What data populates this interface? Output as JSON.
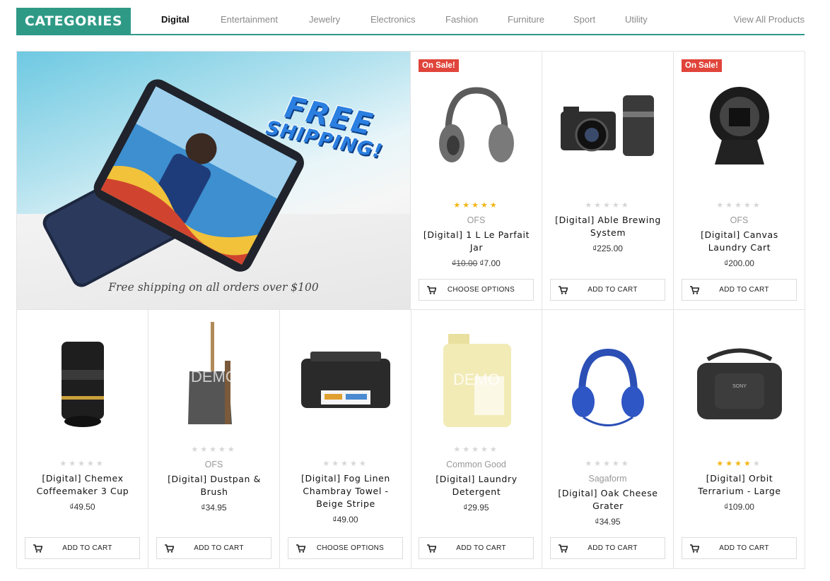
{
  "header": {
    "title": "CATEGORIES",
    "tabs": [
      {
        "label": "Digital",
        "active": true
      },
      {
        "label": "Entertainment",
        "active": false
      },
      {
        "label": "Jewelry",
        "active": false
      },
      {
        "label": "Electronics",
        "active": false
      },
      {
        "label": "Fashion",
        "active": false
      },
      {
        "label": "Furniture",
        "active": false
      },
      {
        "label": "Sport",
        "active": false
      },
      {
        "label": "Utility",
        "active": false
      }
    ],
    "view_all": "View All Products"
  },
  "banner": {
    "headline_line1": "FREE",
    "headline_line2": "SHIPPING!",
    "caption": "Free shipping on all orders over $100"
  },
  "colors": {
    "accent": "#2e9a86",
    "sale_badge": "#e0443a",
    "star_on": "#f3b512",
    "star_off": "#d6d6d6"
  },
  "products": [
    {
      "badge": "On Sale!",
      "image_icon": "headphones-gray-icon",
      "rating": 5,
      "vendor": "OFS",
      "title": "[Digital] 1 L Le Parfait Jar",
      "old_price": "₫10.00",
      "price": "₫7.00",
      "button": "CHOOSE OPTIONS"
    },
    {
      "badge": "",
      "image_icon": "camera-lens-kit-icon",
      "rating": 0,
      "vendor": "",
      "title": "[Digital] Able Brewing System",
      "old_price": "",
      "price": "₫225.00",
      "button": "ADD TO CART"
    },
    {
      "badge": "On Sale!",
      "image_icon": "lens-adapter-icon",
      "rating": 0,
      "vendor": "OFS",
      "title": "[Digital] Canvas Laundry Cart",
      "old_price": "",
      "price": "₫200.00",
      "button": "ADD TO CART"
    },
    {
      "badge": "",
      "image_icon": "zoom-lens-icon",
      "rating": 0,
      "vendor": "",
      "title": "[Digital] Chemex Coffeemaker 3 Cup",
      "old_price": "",
      "price": "₫49.50",
      "button": "ADD TO CART"
    },
    {
      "badge": "",
      "image_icon": "dustpan-brush-icon",
      "rating": 0,
      "vendor": "OFS",
      "title": "[Digital] Dustpan & Brush",
      "old_price": "",
      "price": "₫34.95",
      "button": "ADD TO CART"
    },
    {
      "badge": "",
      "image_icon": "printer-icon",
      "rating": 0,
      "vendor": "",
      "title": "[Digital] Fog Linen Chambray Towel - Beige Stripe",
      "old_price": "",
      "price": "₫49.00",
      "button": "CHOOSE OPTIONS"
    },
    {
      "badge": "",
      "image_icon": "detergent-jug-icon",
      "rating": 0,
      "vendor": "Common Good",
      "title": "[Digital] Laundry Detergent",
      "old_price": "",
      "price": "₫29.95",
      "button": "ADD TO CART"
    },
    {
      "badge": "",
      "image_icon": "headphones-blue-icon",
      "rating": 0,
      "vendor": "Sagaform",
      "title": "[Digital] Oak Cheese Grater",
      "old_price": "",
      "price": "₫34.95",
      "button": "ADD TO CART"
    },
    {
      "badge": "",
      "image_icon": "camera-bag-icon",
      "rating": 4,
      "vendor": "",
      "title": "[Digital] Orbit Terrarium - Large",
      "old_price": "",
      "price": "₫109.00",
      "button": "ADD TO CART"
    }
  ],
  "image_watermark": "DEMO"
}
